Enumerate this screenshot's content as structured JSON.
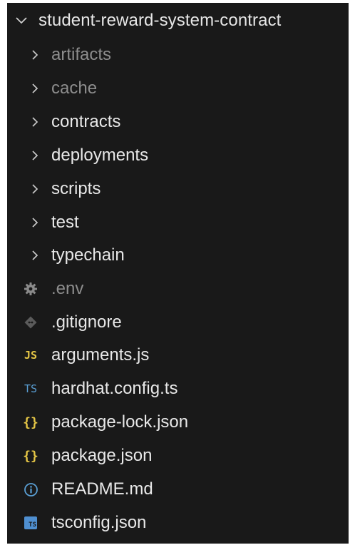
{
  "explorer": {
    "root": {
      "label": "student-reward-system-contract",
      "icon": "chevron-down-icon"
    },
    "folders": [
      {
        "label": "artifacts",
        "dim": true
      },
      {
        "label": "cache",
        "dim": true
      },
      {
        "label": "contracts",
        "dim": false
      },
      {
        "label": "deployments",
        "dim": false
      },
      {
        "label": "scripts",
        "dim": false
      },
      {
        "label": "test",
        "dim": false
      },
      {
        "label": "typechain",
        "dim": false
      }
    ],
    "files": [
      {
        "label": ".env",
        "icon": "gear-icon",
        "icon_text": "",
        "icon_color": "#8a8a8a",
        "dim": true
      },
      {
        "label": ".gitignore",
        "icon": "git-icon",
        "icon_text": "",
        "icon_color": "#5b5b5b",
        "dim": false
      },
      {
        "label": "arguments.js",
        "icon": "javascript-icon",
        "icon_text": "JS",
        "icon_color": "#e5c646",
        "dim": false
      },
      {
        "label": "hardhat.config.ts",
        "icon": "typescript-icon",
        "icon_text": "TS",
        "icon_color": "#5a9fd4",
        "dim": false
      },
      {
        "label": "package-lock.json",
        "icon": "json-icon",
        "icon_text": "{}",
        "icon_color": "#e5c646",
        "dim": false
      },
      {
        "label": "package.json",
        "icon": "json-icon",
        "icon_text": "{}",
        "icon_color": "#e5c646",
        "dim": false
      },
      {
        "label": "README.md",
        "icon": "info-icon",
        "icon_text": "i",
        "icon_color": "#5a9fd4",
        "dim": false
      },
      {
        "label": "tsconfig.json",
        "icon": "tsconfig-icon",
        "icon_text": "TS",
        "icon_color": "#4f8fd0",
        "dim": false
      }
    ]
  }
}
